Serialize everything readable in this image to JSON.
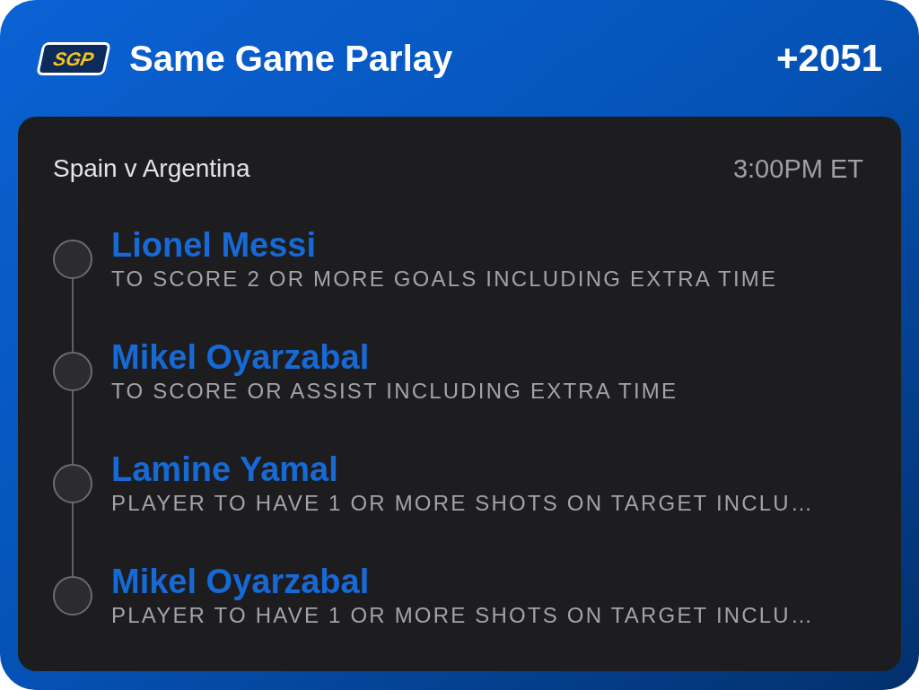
{
  "header": {
    "logo_text": "SGP",
    "title": "Same Game Parlay",
    "odds": "+2051"
  },
  "event": {
    "matchup": "Spain v Argentina",
    "time": "3:00PM ET"
  },
  "legs": [
    {
      "player": "Lionel Messi",
      "market": "TO SCORE 2 OR MORE GOALS INCLUDING EXTRA TIME"
    },
    {
      "player": "Mikel Oyarzabal",
      "market": "TO SCORE OR ASSIST INCLUDING EXTRA TIME"
    },
    {
      "player": "Lamine Yamal",
      "market": "PLAYER TO HAVE 1 OR MORE SHOTS ON TARGET INCLU…"
    },
    {
      "player": "Mikel Oyarzabal",
      "market": "PLAYER TO HAVE 1 OR MORE SHOTS ON TARGET INCLU…"
    }
  ]
}
